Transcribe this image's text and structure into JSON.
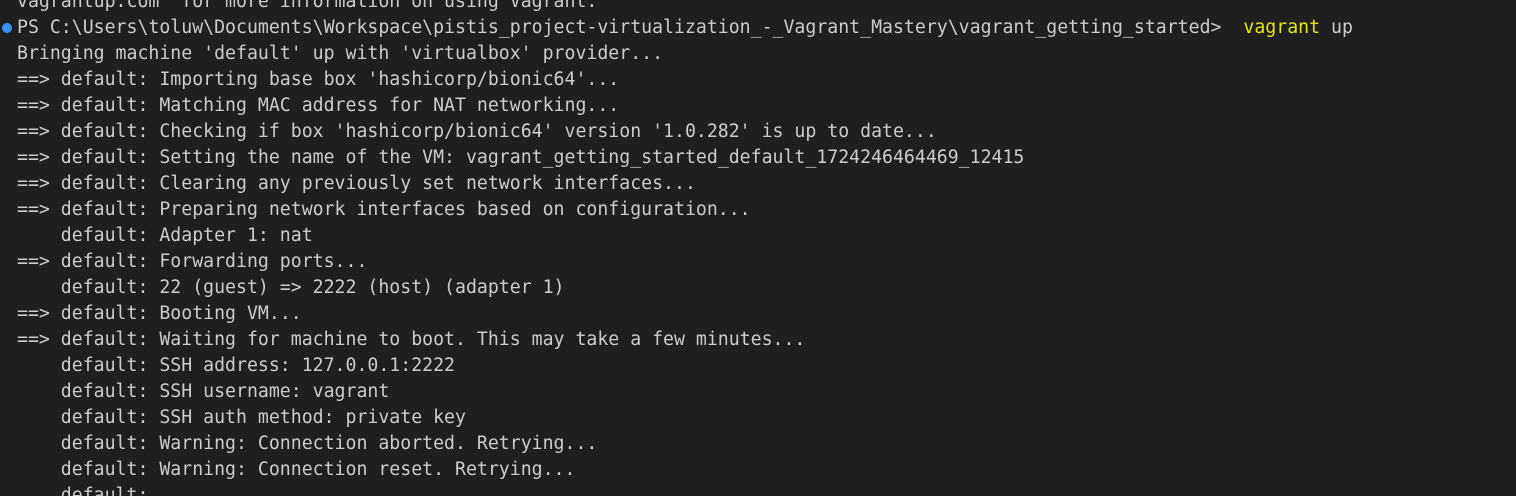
{
  "terminal": {
    "background": "#1f1f1f",
    "foreground": "#cccccc",
    "command_color": "#e5e510",
    "decoration_color": "#3794ff",
    "partial_top_line": "vagrantup.com  for more information on using Vagrant.",
    "prompt": "PS C:\\Users\\toluw\\Documents\\Workspace\\pistis_project-virtualization_-_Vagrant_Mastery\\vagrant_getting_started>  ",
    "command": "vagrant",
    "command_arg": " up",
    "output": [
      "Bringing machine 'default' up with 'virtualbox' provider...",
      "==> default: Importing base box 'hashicorp/bionic64'...",
      "==> default: Matching MAC address for NAT networking...",
      "==> default: Checking if box 'hashicorp/bionic64' version '1.0.282' is up to date...",
      "==> default: Setting the name of the VM: vagrant_getting_started_default_1724246464469_12415",
      "==> default: Clearing any previously set network interfaces...",
      "==> default: Preparing network interfaces based on configuration...",
      "    default: Adapter 1: nat",
      "==> default: Forwarding ports...",
      "    default: 22 (guest) => 2222 (host) (adapter 1)",
      "==> default: Booting VM...",
      "==> default: Waiting for machine to boot. This may take a few minutes...",
      "    default: SSH address: 127.0.0.1:2222",
      "    default: SSH username: vagrant",
      "    default: SSH auth method: private key",
      "    default: Warning: Connection aborted. Retrying...",
      "    default: Warning: Connection reset. Retrying...",
      "    default:"
    ]
  }
}
